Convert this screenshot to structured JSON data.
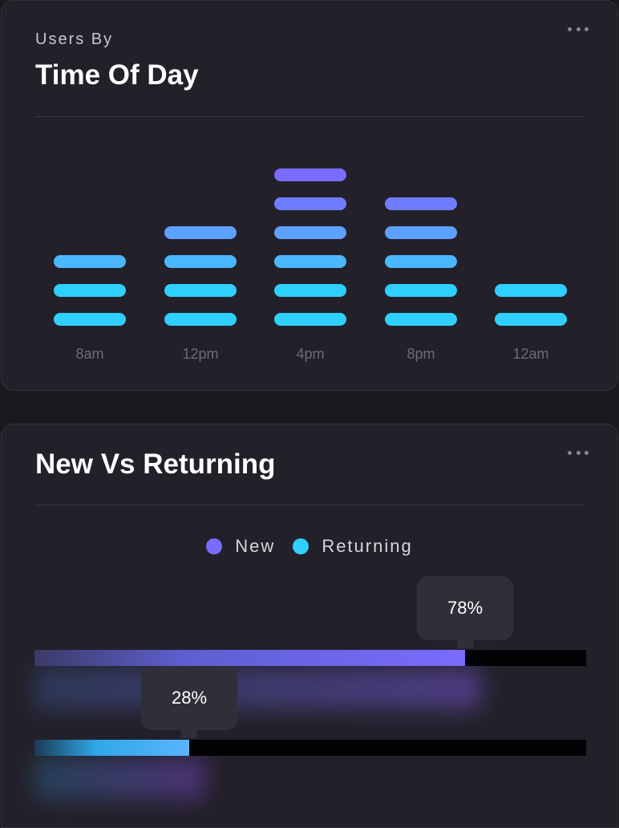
{
  "time_of_day": {
    "subtitle": "Users By",
    "title": "Time Of Day"
  },
  "new_vs_returning": {
    "title": "New Vs Returning"
  },
  "colors": {
    "purple": "#7a6cff",
    "indigo": "#6f7dff",
    "blue": "#5ea0ff",
    "cyan": "#2fcfff",
    "track": "#020104"
  },
  "chart_data": [
    {
      "type": "bar",
      "categories": [
        "8am",
        "12pm",
        "4pm",
        "8pm",
        "12am"
      ],
      "values": [
        3,
        4,
        6,
        5,
        2
      ],
      "title": "Time Of Day",
      "subtitle": "Users By",
      "xlabel": "",
      "ylabel": "",
      "grid": false
    },
    {
      "type": "bar",
      "orientation": "horizontal",
      "categories": [
        "New",
        "Returning"
      ],
      "values": [
        78,
        28
      ],
      "value_labels": [
        "78%",
        "28%"
      ],
      "unit": "%",
      "xlim": [
        0,
        100
      ],
      "title": "New Vs Returning",
      "legend": [
        "New",
        "Returning"
      ],
      "legend_position": "top-center"
    }
  ]
}
